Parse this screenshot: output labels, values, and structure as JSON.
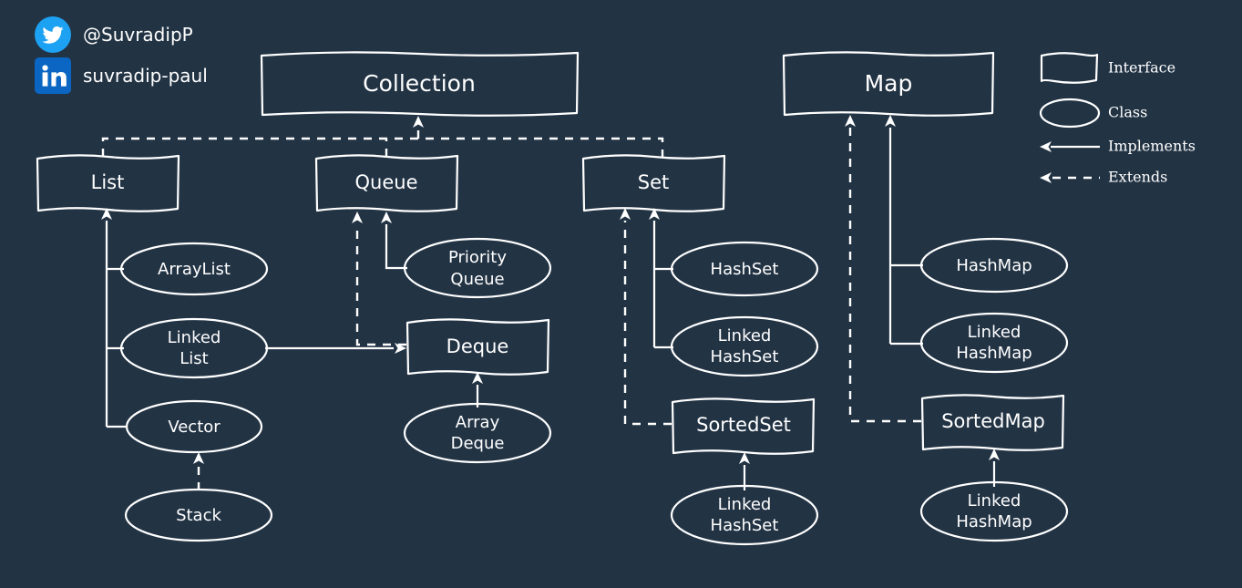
{
  "meta": {
    "title": "Java Collections Framework Hierarchy",
    "background_color": "#223344",
    "stroke_color": "#ffffff"
  },
  "social": {
    "twitter": {
      "icon": "twitter-bird-icon",
      "handle": "@SuvradipP",
      "color": "#1DA1F2"
    },
    "linkedin": {
      "icon": "linkedin-in-icon",
      "handle": "suvradip-paul",
      "color": "#0A66C2"
    }
  },
  "legend": {
    "items": [
      {
        "key": "interface",
        "shape": "rectangle",
        "label": "Interface"
      },
      {
        "key": "class",
        "shape": "ellipse",
        "label": "Class"
      },
      {
        "key": "implements",
        "shape": "solid-arrow",
        "label": "Implements"
      },
      {
        "key": "extends",
        "shape": "dashed-arrow",
        "label": "Extends"
      }
    ]
  },
  "interfaces": {
    "collection": "Collection",
    "map": "Map",
    "list": "List",
    "queue": "Queue",
    "set": "Set",
    "deque": "Deque",
    "sortedset": "SortedSet",
    "sortedmap": "SortedMap"
  },
  "classes": {
    "arraylist": "ArrayList",
    "linkedlist_1": "Linked",
    "linkedlist_2": "List",
    "vector": "Vector",
    "stack": "Stack",
    "priorityqueue_1": "Priority",
    "priorityqueue_2": "Queue",
    "arraydeque_1": "Array",
    "arraydeque_2": "Deque",
    "hashset": "HashSet",
    "linkedhashset_1": "Linked",
    "linkedhashset_2": "HashSet",
    "linkedhashset_sorted_1": "Linked",
    "linkedhashset_sorted_2": "HashSet",
    "hashmap": "HashMap",
    "linkedhashmap_1": "Linked",
    "linkedhashmap_2": "HashMap",
    "linkedhashmap_sorted_1": "Linked",
    "linkedhashmap_sorted_2": "HashMap"
  },
  "relationships": [
    {
      "from": "List",
      "to": "Collection",
      "type": "extends"
    },
    {
      "from": "Queue",
      "to": "Collection",
      "type": "extends"
    },
    {
      "from": "Set",
      "to": "Collection",
      "type": "extends"
    },
    {
      "from": "ArrayList",
      "to": "List",
      "type": "implements"
    },
    {
      "from": "LinkedList",
      "to": "List",
      "type": "implements"
    },
    {
      "from": "Vector",
      "to": "List",
      "type": "implements"
    },
    {
      "from": "Stack",
      "to": "Vector",
      "type": "extends"
    },
    {
      "from": "PriorityQueue",
      "to": "Queue",
      "type": "implements"
    },
    {
      "from": "Deque",
      "to": "Queue",
      "type": "extends"
    },
    {
      "from": "LinkedList",
      "to": "Deque",
      "type": "implements"
    },
    {
      "from": "ArrayDeque",
      "to": "Deque",
      "type": "implements"
    },
    {
      "from": "HashSet",
      "to": "Set",
      "type": "implements"
    },
    {
      "from": "LinkedHashSet",
      "to": "Set",
      "type": "implements"
    },
    {
      "from": "SortedSet",
      "to": "Set",
      "type": "extends"
    },
    {
      "from": "LinkedHashSet",
      "to": "SortedSet",
      "type": "implements"
    },
    {
      "from": "HashMap",
      "to": "Map",
      "type": "implements"
    },
    {
      "from": "LinkedHashMap",
      "to": "Map",
      "type": "implements"
    },
    {
      "from": "SortedMap",
      "to": "Map",
      "type": "extends"
    },
    {
      "from": "LinkedHashMap",
      "to": "SortedMap",
      "type": "implements"
    }
  ]
}
